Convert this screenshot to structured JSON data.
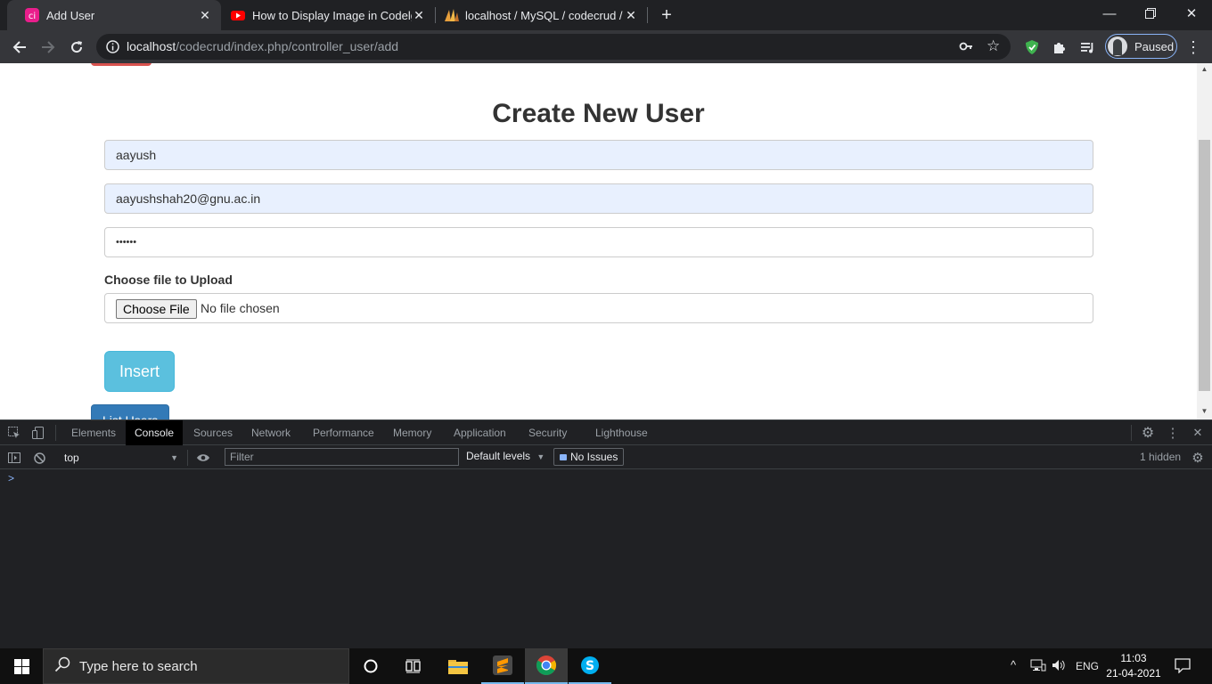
{
  "browser": {
    "tabs": [
      {
        "title": "Add User",
        "favicon": "codeigniter-favicon"
      },
      {
        "title": "How to Display Image in Codelgn",
        "favicon": "youtube-favicon"
      },
      {
        "title": "localhost / MySQL / codecrud / u",
        "favicon": "phpmyadmin-favicon"
      }
    ],
    "url_host": "localhost",
    "url_path": "/codecrud/index.php/controller_user/add",
    "profile_label": "Paused"
  },
  "page": {
    "title": "Create New User",
    "name_value": "aayush",
    "email_value": "aayushshah20@gnu.ac.in",
    "password_masked": "••••••",
    "file_label": "Choose file to Upload",
    "choose_file_label": "Choose File",
    "no_file_text": "No file chosen",
    "insert_label": "Insert",
    "list_users_label": "List Users"
  },
  "devtools": {
    "tabs": [
      "Elements",
      "Console",
      "Sources",
      "Network",
      "Performance",
      "Memory",
      "Application",
      "Security",
      "Lighthouse"
    ],
    "active_tab": "Console",
    "context": "top",
    "filter_placeholder": "Filter",
    "levels": "Default levels",
    "issues": "No Issues",
    "hidden_count": "1 hidden",
    "prompt": ">"
  },
  "taskbar": {
    "search_placeholder": "Type here to search",
    "language": "ENG",
    "time": "11:03",
    "date": "21-04-2021"
  },
  "colors": {
    "insert_button": "#5bc0de",
    "list_users_button": "#337ab7",
    "autofill_bg": "#e8f0fe",
    "devtools_bg": "#202124"
  }
}
